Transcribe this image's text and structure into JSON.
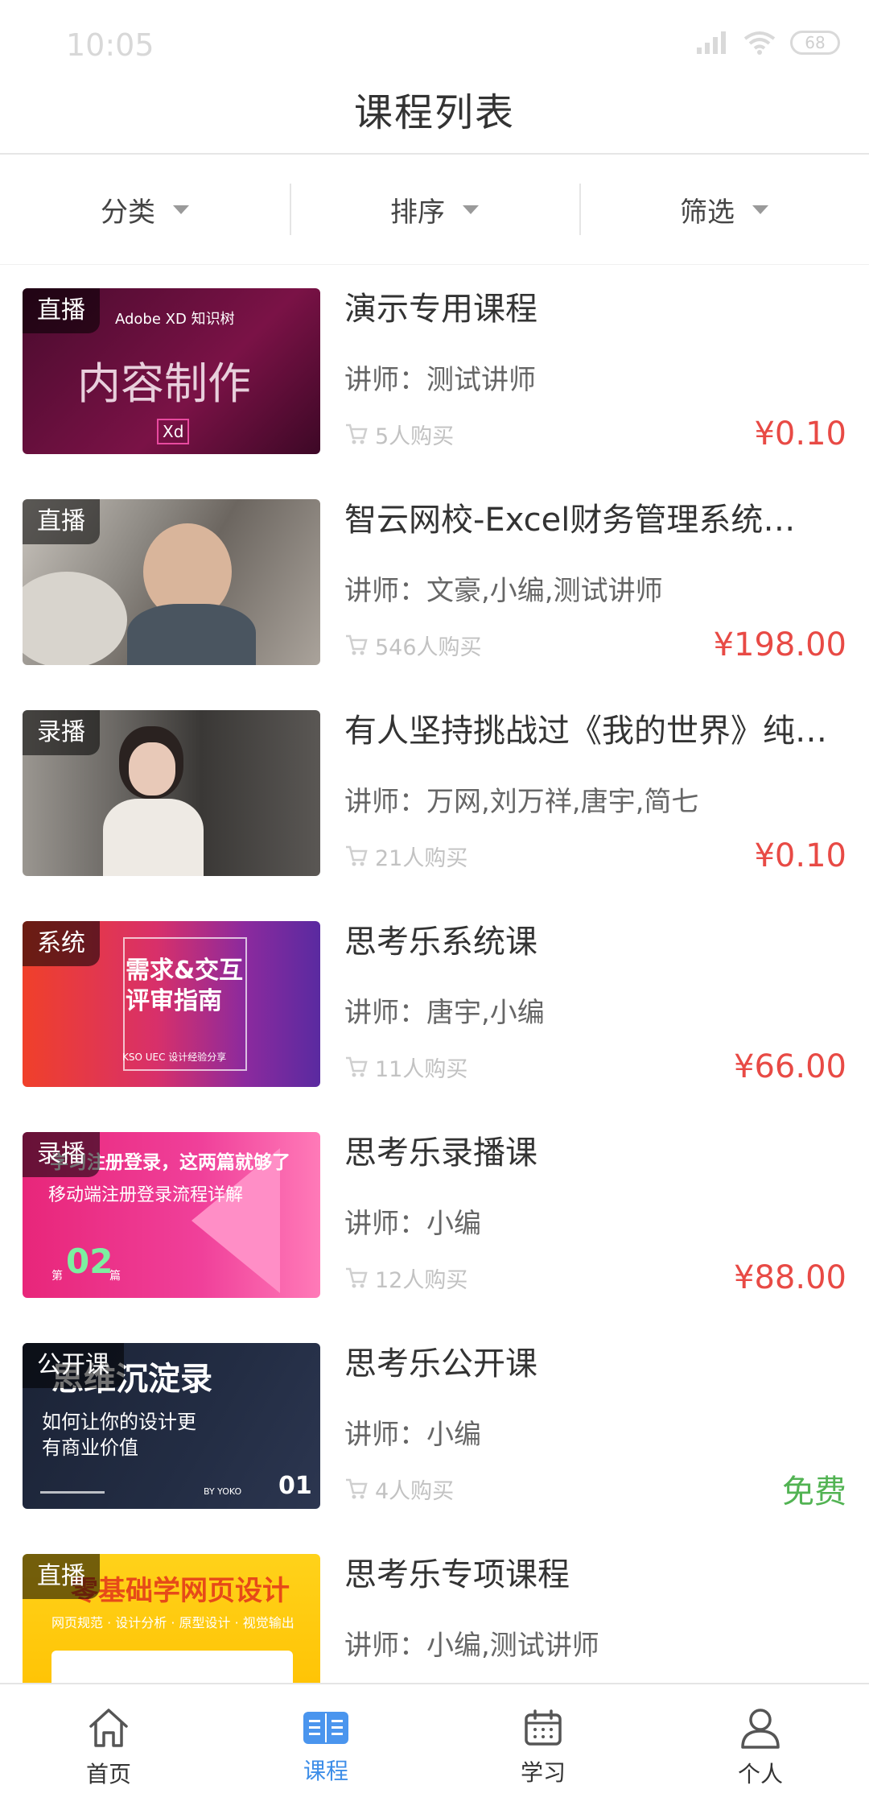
{
  "status_bar": {
    "time": "10:05",
    "battery": "68"
  },
  "header": {
    "title": "课程列表"
  },
  "filters": [
    {
      "label": "分类"
    },
    {
      "label": "排序"
    },
    {
      "label": "筛选"
    }
  ],
  "courses": [
    {
      "badge": "直播",
      "title": "演示专用课程",
      "teacher": "讲师：测试讲师",
      "buyers": "5人购买",
      "price": "¥0.10",
      "thumb_text": [
        "Adobe XD 知识树",
        "内容制作",
        "Xd"
      ]
    },
    {
      "badge": "直播",
      "title": "智云网校-Excel财务管理系统…",
      "teacher": "讲师：文豪,小编,测试讲师",
      "buyers": "546人购买",
      "price": "¥198.00",
      "thumb_text": []
    },
    {
      "badge": "录播",
      "title": "有人坚持挑战过《我的世界》纯…",
      "teacher": "讲师：万网,刘万祥,唐宇,简七",
      "buyers": "21人购买",
      "price": "¥0.10",
      "thumb_text": []
    },
    {
      "badge": "系统",
      "title": "思考乐系统课",
      "teacher": "讲师：唐宇,小编",
      "buyers": "11人购买",
      "price": "¥66.00",
      "thumb_text": [
        "需求&交互",
        "评审指南",
        "KSO UEC 设计经验分享"
      ]
    },
    {
      "badge": "录播",
      "title": "思考乐录播课",
      "teacher": "讲师：小编",
      "buyers": "12人购买",
      "price": "¥88.00",
      "thumb_text": [
        "学习注册登录，这两篇就够了",
        "移动端注册登录流程详解",
        "第",
        "02",
        "篇"
      ]
    },
    {
      "badge": "公开课",
      "title": "思考乐公开课",
      "teacher": "讲师：小编",
      "buyers": "4人购买",
      "price": "免费",
      "thumb_text": [
        "思维沉淀录",
        "如何让你的设计更",
        "有商业价值",
        "BY YOKO",
        "01"
      ]
    },
    {
      "badge": "直播",
      "title": "思考乐专项课程",
      "teacher": "讲师：小编,测试讲师",
      "buyers": "",
      "price": "",
      "thumb_text": [
        "零基础学网页设计",
        "网页规范 · 设计分析 · 原型设计 · 视觉输出"
      ]
    }
  ],
  "tabs": [
    {
      "label": "首页",
      "icon": "home-icon"
    },
    {
      "label": "课程",
      "icon": "book-icon",
      "active": true
    },
    {
      "label": "学习",
      "icon": "calendar-icon"
    },
    {
      "label": "个人",
      "icon": "user-icon"
    }
  ],
  "colors": {
    "price": "#e84a45",
    "free": "#52b353",
    "active_tab": "#3e8ee8"
  }
}
